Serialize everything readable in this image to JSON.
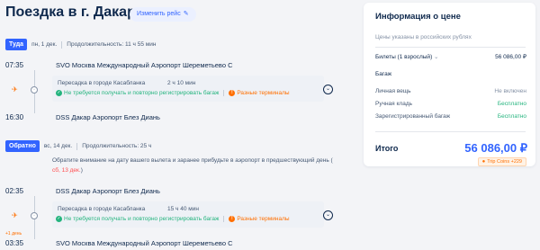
{
  "header": {
    "title": "Поездка в г. Дакар",
    "change_label": "Изменить рейс"
  },
  "outbound": {
    "badge": "Туда",
    "date": "пн, 1 дек.",
    "duration": "Продолжительность: 11 ч 55 мин",
    "dep_time": "07:35",
    "dep_airport": "SVO Москва Международный Аэропорт Шереметьево С",
    "transfer_city": "Пересадка в городе Касабланка",
    "transfer_duration": "2 ч 10 мин",
    "baggage_ok": "Не требуется получать и повторно регистрировать багаж",
    "terminals": "Разные терминалы",
    "arr_time": "16:30",
    "arr_airport": "DSS Дакар Аэропорт Блез Диань"
  },
  "return": {
    "badge": "Обратно",
    "date": "вс, 14 дек.",
    "duration": "Продолжительность: 25 ч",
    "notice_main": "Обратите внимание на дату вашего вылета и заранее прибудьте в аэропорт в предшествующий день (",
    "notice_date": "сб, 13 дек.",
    "notice_end": ")",
    "dep_time": "02:35",
    "dep_airport": "DSS Дакар Аэропорт Блез Диань",
    "transfer_city": "Пересадка в городе Касабланка",
    "transfer_duration": "15 ч 40 мин",
    "baggage_ok": "Не требуется получать и повторно регистрировать багаж",
    "terminals": "Разные терминалы",
    "arr_time": "03:35",
    "arr_day": "+1 день",
    "arr_airport": "SVO Москва Международный Аэропорт Шереметьево С"
  },
  "price": {
    "title": "Информация о цене",
    "subtitle": "Цены указаны в российских рублях",
    "tickets_label": "Билеты (1 взрослый)",
    "tickets_value": "56 086,00 ₽",
    "baggage_head": "Багаж",
    "personal_label": "Личная вещь",
    "personal_value": "Не включен",
    "carry_label": "Ручная кладь",
    "carry_value": "Бесплатно",
    "checked_label": "Зарегистрированный багаж",
    "checked_value": "Бесплатно",
    "total_label": "Итого",
    "total_value": "56 086,00 ₽",
    "coins": "Trip Coins +229"
  },
  "icons": {
    "plane": "plane-icon",
    "expand": "chevron-down-icon",
    "check": "check-circle-icon",
    "warning": "warning-icon",
    "coin": "coin-icon"
  },
  "colors": {
    "accent": "#3264ff",
    "success": "#24b47e",
    "warning": "#ff6f00",
    "danger": "#ff4d4f",
    "text": "#0f294d"
  }
}
